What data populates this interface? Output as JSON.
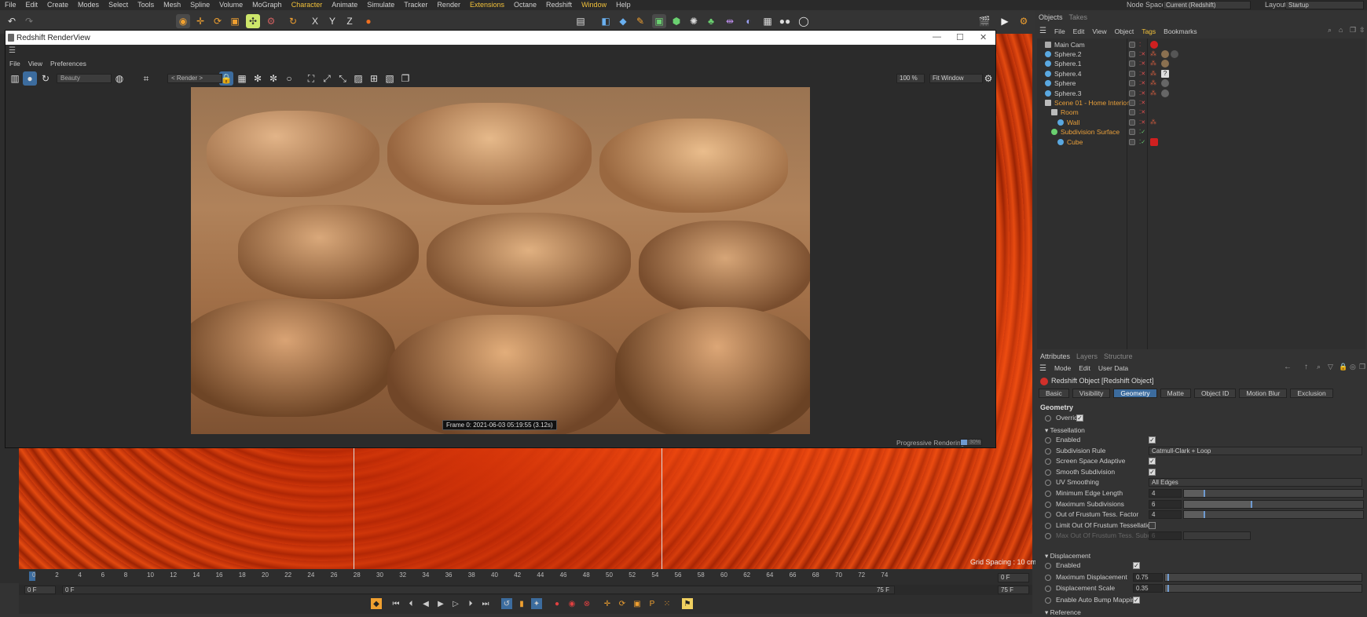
{
  "menubar": {
    "items": [
      {
        "label": "File",
        "hl": false
      },
      {
        "label": "Edit",
        "hl": false
      },
      {
        "label": "Create",
        "hl": false
      },
      {
        "label": "Modes",
        "hl": false
      },
      {
        "label": "Select",
        "hl": false
      },
      {
        "label": "Tools",
        "hl": false
      },
      {
        "label": "Mesh",
        "hl": false
      },
      {
        "label": "Spline",
        "hl": false
      },
      {
        "label": "Volume",
        "hl": false
      },
      {
        "label": "MoGraph",
        "hl": false
      },
      {
        "label": "Character",
        "hl": true
      },
      {
        "label": "Animate",
        "hl": false
      },
      {
        "label": "Simulate",
        "hl": false
      },
      {
        "label": "Tracker",
        "hl": false
      },
      {
        "label": "Render",
        "hl": false
      },
      {
        "label": "Extensions",
        "hl": true
      },
      {
        "label": "Octane",
        "hl": false
      },
      {
        "label": "Redshift",
        "hl": false
      },
      {
        "label": "Window",
        "hl": true
      },
      {
        "label": "Help",
        "hl": false
      }
    ],
    "nodespace_label": "Node Space:",
    "nodespace_value": "Current (Redshift)",
    "layout_label": "Layout:",
    "layout_value": "Startup"
  },
  "renderview": {
    "title": "Redshift RenderView",
    "menu": [
      "File",
      "View",
      "Preferences"
    ],
    "aov": "Beauty",
    "camera": "< Render >",
    "zoom": "100 %",
    "fit": "Fit Window",
    "frame_label": "Frame  0:  2021-06-03  05:19:55  (3.12s)",
    "status": "Progressive Rendering...",
    "progress_pct": "30%",
    "progress": 0.3
  },
  "viewport": {
    "grid_spacing": "Grid Spacing : 10 cm"
  },
  "timeline": {
    "ticks": [
      "0",
      "2",
      "4",
      "6",
      "8",
      "10",
      "12",
      "14",
      "16",
      "18",
      "20",
      "22",
      "24",
      "26",
      "28",
      "30",
      "32",
      "34",
      "36",
      "38",
      "40",
      "42",
      "44",
      "46",
      "48",
      "50",
      "52",
      "54",
      "56",
      "58",
      "60",
      "62",
      "64",
      "66",
      "68",
      "70",
      "72",
      "74"
    ],
    "current_frame": "0 F",
    "start": "0 F",
    "start2": "0 F",
    "end": "75 F",
    "end2": "75 F"
  },
  "objects": {
    "tabs": [
      "Objects",
      "Takes"
    ],
    "menu": [
      {
        "label": "File",
        "hl": false
      },
      {
        "label": "Edit",
        "hl": false
      },
      {
        "label": "View",
        "hl": false
      },
      {
        "label": "Object",
        "hl": false
      },
      {
        "label": "Tags",
        "hl": true
      },
      {
        "label": "Bookmarks",
        "hl": false
      }
    ],
    "rows": [
      {
        "name": "Main Cam",
        "indent": 0,
        "orange": false,
        "icon": "camera-icon"
      },
      {
        "name": "Sphere.2",
        "indent": 0,
        "orange": false,
        "icon": "sphere-icon"
      },
      {
        "name": "Sphere.1",
        "indent": 0,
        "orange": false,
        "icon": "sphere-icon"
      },
      {
        "name": "Sphere.4",
        "indent": 0,
        "orange": false,
        "icon": "sphere-icon"
      },
      {
        "name": "Sphere",
        "indent": 0,
        "orange": false,
        "icon": "sphere-icon"
      },
      {
        "name": "Sphere.3",
        "indent": 0,
        "orange": false,
        "icon": "sphere-icon"
      },
      {
        "name": "Scene 01 - Home Interior",
        "indent": 0,
        "orange": true,
        "icon": "null-icon"
      },
      {
        "name": "Room",
        "indent": 1,
        "orange": true,
        "icon": "null-icon"
      },
      {
        "name": "Wall",
        "indent": 2,
        "orange": true,
        "icon": "cube-icon"
      },
      {
        "name": "Subdivision Surface",
        "indent": 1,
        "orange": true,
        "icon": "subdivision-icon"
      },
      {
        "name": "Cube",
        "indent": 2,
        "orange": true,
        "icon": "cube-icon"
      }
    ]
  },
  "attributes": {
    "tabs": [
      "Attributes",
      "Layers",
      "Structure"
    ],
    "menu": [
      "Mode",
      "Edit",
      "User Data"
    ],
    "title": "Redshift Object [Redshift Object]",
    "pagetabs": [
      {
        "label": "Basic",
        "active": false
      },
      {
        "label": "Visibility",
        "active": false
      },
      {
        "label": "Geometry",
        "active": true
      },
      {
        "label": "Matte",
        "active": false
      },
      {
        "label": "Object ID",
        "active": false
      },
      {
        "label": "Motion Blur",
        "active": false
      },
      {
        "label": "Exclusion",
        "active": false
      }
    ],
    "section": "Geometry",
    "override_label": "Override",
    "tess_group": "Tessellation",
    "tess_rows": [
      {
        "label": "Enabled",
        "type": "check",
        "checked": true
      },
      {
        "label": "Subdivision Rule",
        "type": "select",
        "value": "Catmull-Clark + Loop"
      },
      {
        "label": "Screen Space Adaptive",
        "type": "check",
        "checked": true
      },
      {
        "label": "Smooth Subdivision",
        "type": "check",
        "checked": true
      },
      {
        "label": "UV Smoothing",
        "type": "select",
        "value": "All Edges"
      },
      {
        "label": "Minimum Edge Length",
        "type": "slider",
        "value": "4",
        "frac": 0.12
      },
      {
        "label": "Maximum Subdivisions",
        "type": "slider",
        "value": "6",
        "frac": 0.38
      },
      {
        "label": "Out of Frustum Tess. Factor",
        "type": "slider",
        "value": "4",
        "frac": 0.12
      },
      {
        "label": "Limit Out Of Frustum Tessellation",
        "type": "check",
        "checked": false
      },
      {
        "label": "Max Out Of Frustum Tess. Subdivs",
        "type": "dimslider",
        "value": "6",
        "dim": true
      }
    ],
    "disp_group": "Displacement",
    "disp_rows": [
      {
        "label": "Enabled",
        "type": "check",
        "checked": true
      },
      {
        "label": "Maximum Displacement",
        "type": "slider2",
        "value": "0.75",
        "frac": 0.02
      },
      {
        "label": "Displacement Scale",
        "type": "slider2",
        "value": "0.35",
        "frac": 0.02
      },
      {
        "label": "Enable Auto Bump Mapping",
        "type": "check",
        "checked": true
      }
    ],
    "ref_group": "Reference"
  }
}
